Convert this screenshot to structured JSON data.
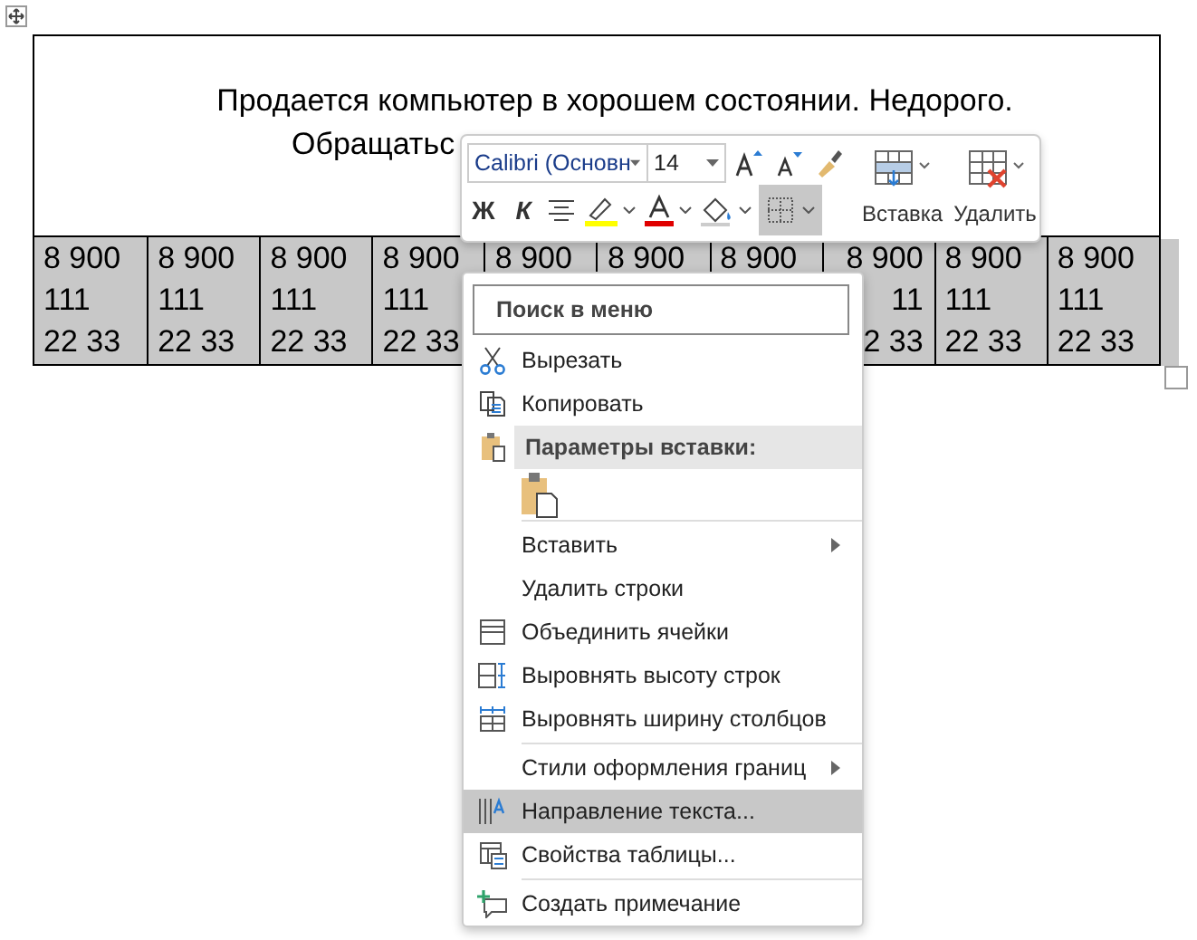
{
  "document": {
    "lines": [
      "Продается компьютер в хорошем состоянии. Недорого.",
      "Обращатьс"
    ]
  },
  "phone_cells": [
    {
      "lines": [
        "8 900",
        "111",
        "22 33"
      ],
      "selected": true,
      "kind": "full"
    },
    {
      "lines": [
        "8 900",
        "111",
        "22 33"
      ],
      "selected": true,
      "kind": "full"
    },
    {
      "lines": [
        "8 900",
        "111",
        "22 33"
      ],
      "selected": true,
      "kind": "full"
    },
    {
      "lines": [
        "8 900",
        "111",
        "22 33"
      ],
      "selected": true,
      "kind": "full"
    },
    {
      "lines": [
        "8 900"
      ],
      "selected": true,
      "kind": "full"
    },
    {
      "lines": [
        "8 900"
      ],
      "selected": true,
      "kind": "full"
    },
    {
      "lines": [
        "8 900"
      ],
      "selected": true,
      "kind": "full"
    },
    {
      "lines": [
        "8 900",
        "11",
        "2 33"
      ],
      "selected": true,
      "kind": "clipped"
    },
    {
      "lines": [
        "8 900",
        "111",
        "22 33"
      ],
      "selected": true,
      "kind": "full"
    },
    {
      "lines": [
        "8 900",
        "111",
        "22 33"
      ],
      "selected": true,
      "kind": "full"
    }
  ],
  "mini_toolbar": {
    "font": "Calibri (Основн",
    "size": "14",
    "bold": "Ж",
    "italic": "К",
    "borders_selected": true,
    "insert": "Вставка",
    "delete": "Удалить"
  },
  "context_menu": {
    "search": {
      "placeholder": "Поиск в меню"
    },
    "items": [
      {
        "kind": "item",
        "label": "Вырезать",
        "submenu": false,
        "selected": false
      },
      {
        "kind": "item",
        "label": "Копировать",
        "submenu": false,
        "selected": false
      },
      {
        "kind": "header",
        "label": "Параметры вставки:"
      },
      {
        "kind": "paste"
      },
      {
        "kind": "separator"
      },
      {
        "kind": "item",
        "label": "Вставить",
        "submenu": true,
        "selected": false
      },
      {
        "kind": "item",
        "label": "Удалить строки",
        "submenu": false,
        "selected": false
      },
      {
        "kind": "item",
        "label": "Объединить ячейки",
        "submenu": false,
        "selected": false
      },
      {
        "kind": "item",
        "label": "Выровнять высоту строк",
        "submenu": false,
        "selected": false
      },
      {
        "kind": "item",
        "label": "Выровнять ширину столбцов",
        "submenu": false,
        "selected": false
      },
      {
        "kind": "separator"
      },
      {
        "kind": "item",
        "label": "Стили оформления границ",
        "submenu": true,
        "selected": false
      },
      {
        "kind": "item",
        "label": "Направление текста...",
        "submenu": false,
        "selected": true
      },
      {
        "kind": "item",
        "label": "Свойства таблицы...",
        "submenu": false,
        "selected": false
      },
      {
        "kind": "separator"
      },
      {
        "kind": "item",
        "label": "Создать примечание",
        "submenu": false,
        "selected": false
      }
    ]
  }
}
